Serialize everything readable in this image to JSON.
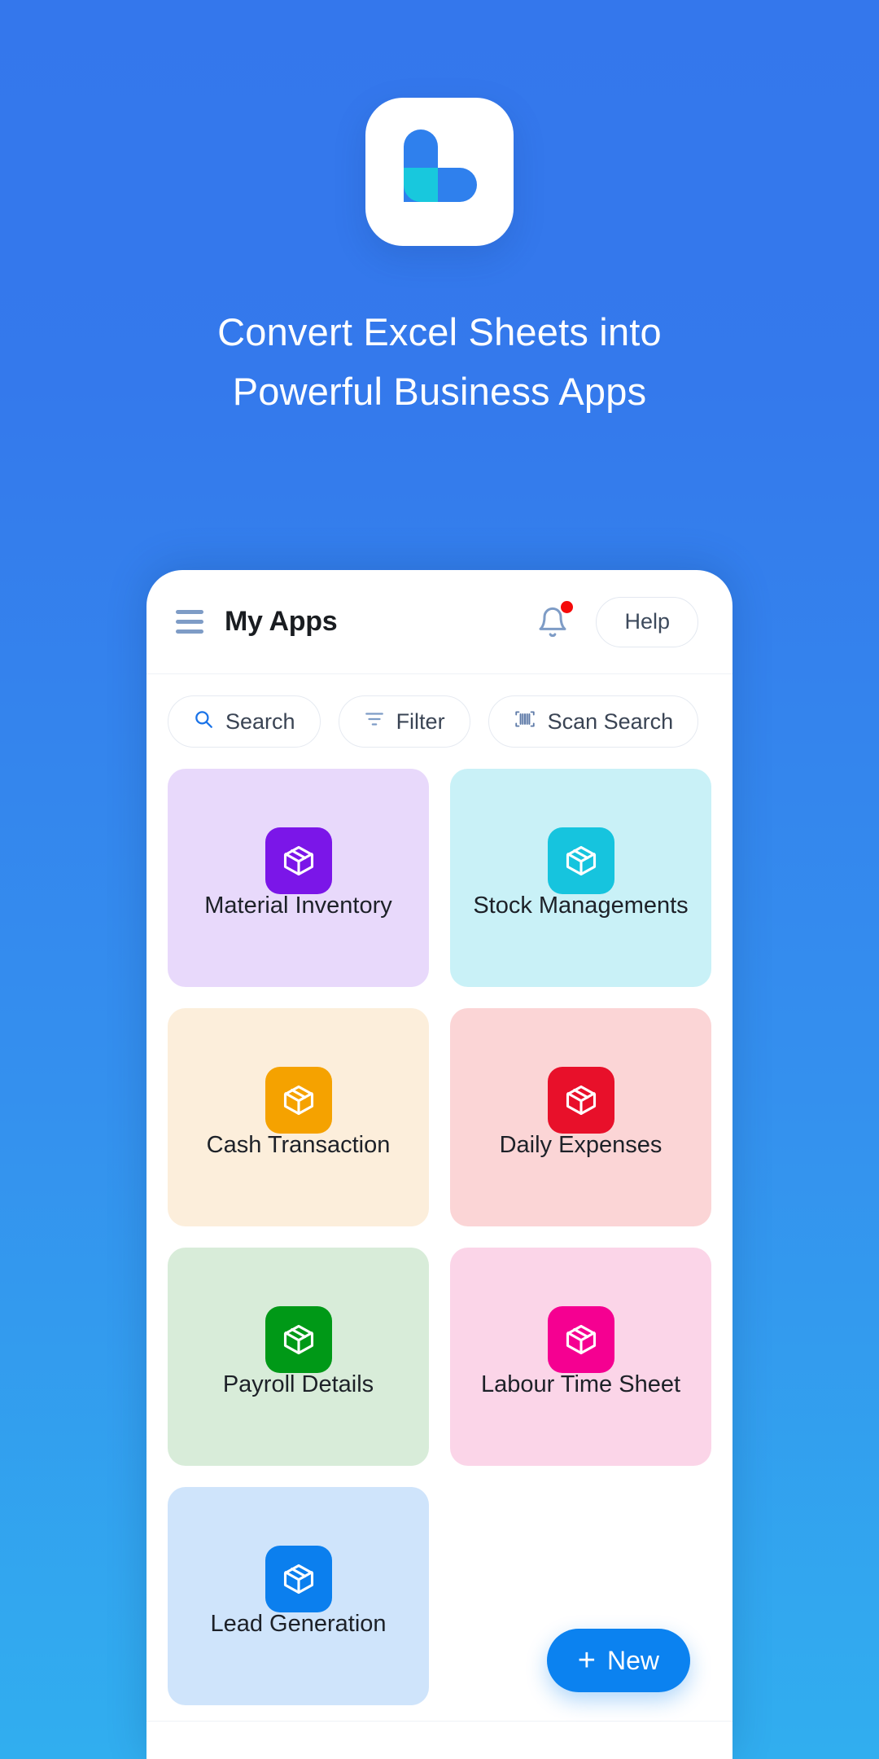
{
  "theme": {
    "bg_top": "#3477ec",
    "bg_bottom": "#31aeef",
    "accent": "#0b82f0",
    "logo_blue": "#2f80ed",
    "logo_cyan": "#18c8dd",
    "badge_red_dot": "#f50a0a"
  },
  "hero": {
    "logo_icon": "app-logo-b-mark",
    "headline_line1": "Convert Excel Sheets into",
    "headline_line2": "Powerful Business Apps"
  },
  "phone": {
    "appbar": {
      "menu_icon": "hamburger-menu-icon",
      "title": "My Apps",
      "bell_icon": "notification-bell-icon",
      "has_notification": true,
      "help_label": "Help"
    },
    "filterbar": [
      {
        "label": "Search",
        "icon": "search-icon"
      },
      {
        "label": "Filter",
        "icon": "filter-icon"
      },
      {
        "label": "Scan Search",
        "icon": "barcode-scan-icon"
      }
    ],
    "apps": [
      {
        "label": "Material Inventory",
        "icon": "package-box-icon",
        "badge_color": "#7b16e8",
        "card_color": "#e8d9fb"
      },
      {
        "label": "Stock Managements",
        "icon": "package-box-icon",
        "badge_color": "#16c4de",
        "card_color": "#c9f1f7"
      },
      {
        "label": "Cash Transaction",
        "icon": "package-box-icon",
        "badge_color": "#f5a200",
        "card_color": "#fceedb"
      },
      {
        "label": "Daily Expenses",
        "icon": "package-box-icon",
        "badge_color": "#e8102a",
        "card_color": "#fbd5d6"
      },
      {
        "label": "Payroll Details",
        "icon": "package-box-icon",
        "badge_color": "#009917",
        "card_color": "#d8ecd9"
      },
      {
        "label": "Labour Time Sheet",
        "icon": "package-box-icon",
        "badge_color": "#f50091",
        "card_color": "#fbd5e8"
      },
      {
        "label": "Lead Generation",
        "icon": "package-box-icon",
        "badge_color": "#0b7fee",
        "card_color": "#cfe4fb"
      }
    ],
    "fab": {
      "plus": "+",
      "label": "New",
      "icon": "plus-icon"
    }
  }
}
